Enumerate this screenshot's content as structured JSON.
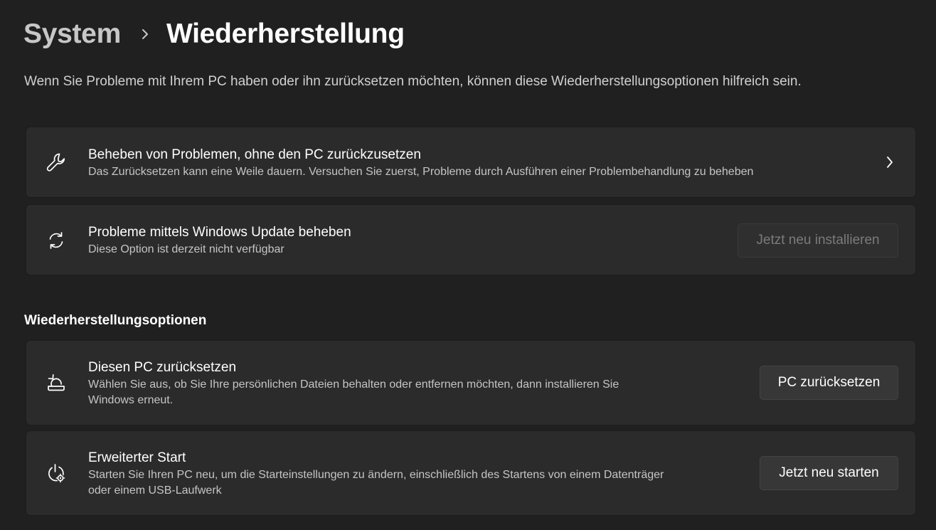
{
  "breadcrumb": {
    "parent": "System",
    "current": "Wiederherstellung"
  },
  "intro": "Wenn Sie Probleme mit Ihrem PC haben oder ihn zurücksetzen möchten, können diese Wiederherstellungsoptionen hilfreich sein.",
  "cards": [
    {
      "icon": "wrench-icon",
      "title": "Beheben von Problemen, ohne den PC zurückzusetzen",
      "desc": "Das Zurücksetzen kann eine Weile dauern. Versuchen Sie zuerst, Probleme durch Ausführen einer Problembehandlung zu beheben"
    },
    {
      "icon": "refresh-icon",
      "title": "Probleme mittels Windows Update beheben",
      "desc": "Diese Option ist derzeit nicht verfügbar",
      "button": "Jetzt neu installieren"
    }
  ],
  "section": {
    "title": "Wiederherstellungsoptionen",
    "items": [
      {
        "icon": "reset-pc-icon",
        "title": "Diesen PC zurücksetzen",
        "desc_line1": "Wählen Sie aus, ob Sie Ihre persönlichen Dateien behalten oder entfernen möchten, dann installieren Sie",
        "desc_line2": "Windows erneut.",
        "button": "PC zurücksetzen"
      },
      {
        "icon": "advanced-startup-icon",
        "title": "Erweiterter Start",
        "desc_line1": "Starten Sie Ihren PC neu, um die Starteinstellungen zu ändern, einschließlich des Startens von einem Datenträger",
        "desc_line2": "oder einem USB-Laufwerk",
        "button": "Jetzt neu starten"
      }
    ]
  },
  "colors": {
    "background": "#202020",
    "card": "#2b2b2b",
    "button": "#373737",
    "disabled_text": "#7b7b7b"
  }
}
